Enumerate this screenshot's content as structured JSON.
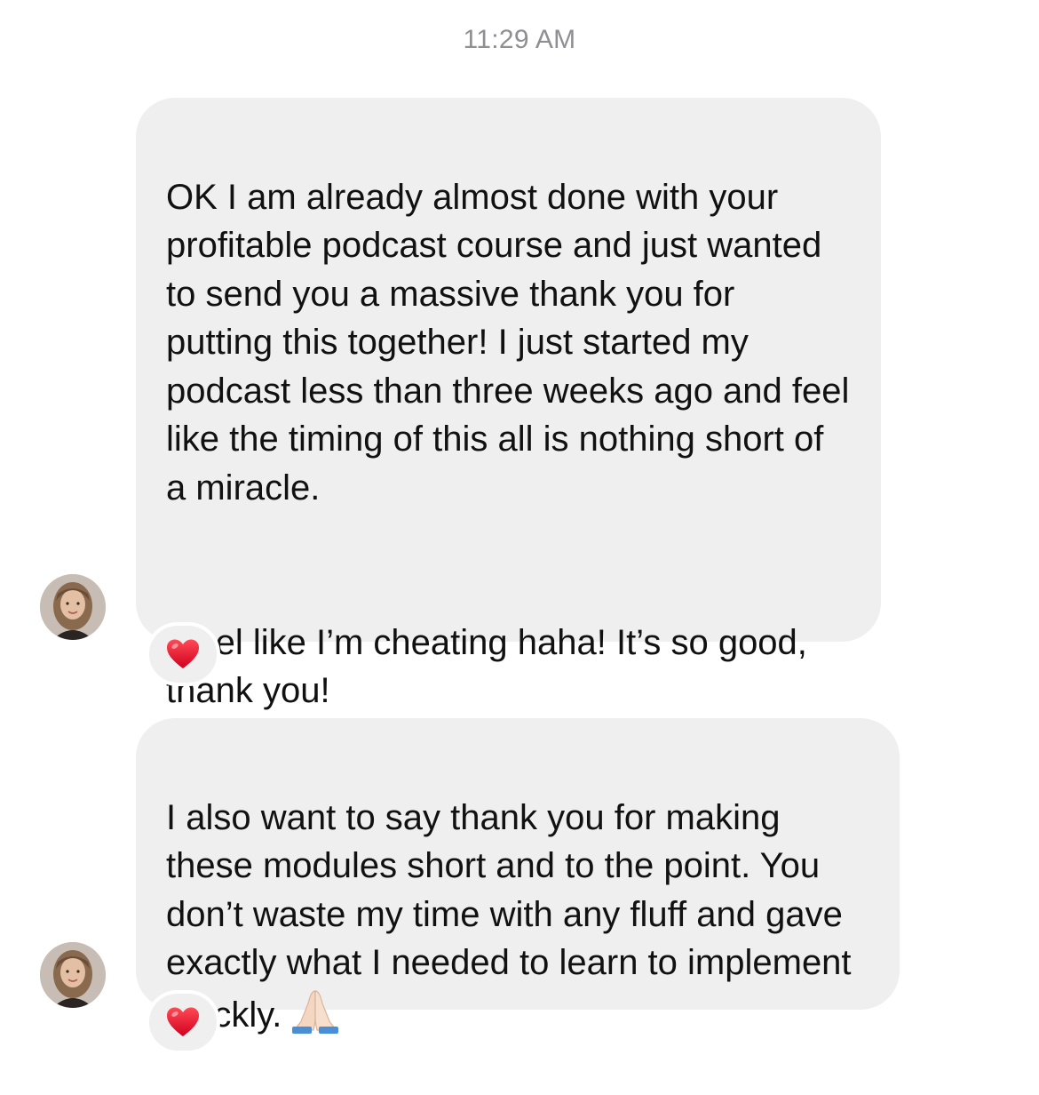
{
  "timestamp": "11:29 AM",
  "messages": [
    {
      "paragraphs": [
        "OK I am already almost done with your profitable podcast course and just wanted to send you a massive thank you for putting this together! I just started my podcast less than three weeks ago and feel like the timing of this all is nothing short of a miracle.",
        "I feel like I’m cheating haha! It’s so good, thank you!"
      ],
      "reaction": "heart-emoji"
    },
    {
      "paragraphs": [
        "I also want to say thank you for making these modules short and to the point. You don’t waste my time with any fluff and gave exactly what I needed to learn to implement quickly."
      ],
      "trailing_emoji": "folded-hands-emoji",
      "reaction": "heart-emoji"
    }
  ],
  "colors": {
    "bubble_bg": "#efefef",
    "timestamp": "#8e8e93",
    "heart": "#e8102a"
  }
}
